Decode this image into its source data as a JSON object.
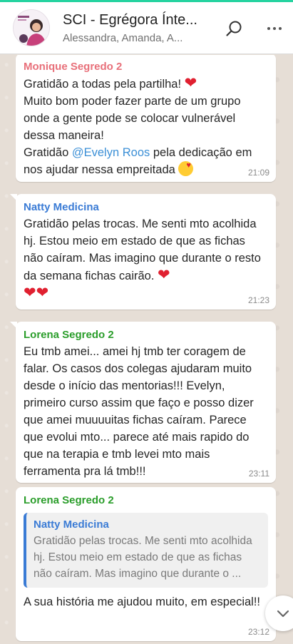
{
  "header": {
    "title": "SCI - Egrégora Ínte...",
    "subtitle": "Alessandra, Amanda, A..."
  },
  "messages": [
    {
      "sender": "Monique Segredo 2",
      "sender_color": "#e8707a",
      "lines": [
        "Gratidão a todas pela partilha! ",
        "Muito bom poder fazer parte de um grupo onde a gente pode se colocar vulnerável dessa maneira!",
        "Gratidão ",
        "@Evelyn Roos",
        " pela dedicação em nos ajudar nessa empreitada "
      ],
      "time": "21:09"
    },
    {
      "sender": "Natty Medicina",
      "sender_color": "#3a7bd5",
      "text": "Gratidão pelas trocas. Me senti mto acolhida hj. Estou meio em estado de que as fichas não caíram. Mas imagino que durante o resto da semana fichas cairão. ",
      "time": "21:23"
    },
    {
      "sender": "Lorena Segredo 2",
      "sender_color": "#2a9d2a",
      "text": "Eu tmb amei... amei hj tmb ter coragem de falar. Os casos dos colegas ajudaram muito desde o início das mentorias!!! Evelyn, primeiro curso assim que faço e posso dizer que amei muuuuitas fichas caíram. Parece que evolui mto... parece até mais rapido do que na terapia e tmb levei mto mais ferramenta pra lá tmb!!!",
      "time": "23:11"
    },
    {
      "sender": "Lorena Segredo 2",
      "sender_color": "#2a9d2a",
      "quote": {
        "sender": "Natty Medicina",
        "text": "Gratidão pelas trocas. Me senti mto acolhida hj. Estou meio em estado de que as fichas não caíram. Mas imagino que durante o ..."
      },
      "text": "A sua história me ajudou muito, em especial!!",
      "time": "23:12"
    }
  ],
  "icons": [
    "search-icon",
    "more-vert-icon",
    "chevron-down-icon",
    "heart-emoji",
    "smiling-face-with-hearts-emoji"
  ]
}
